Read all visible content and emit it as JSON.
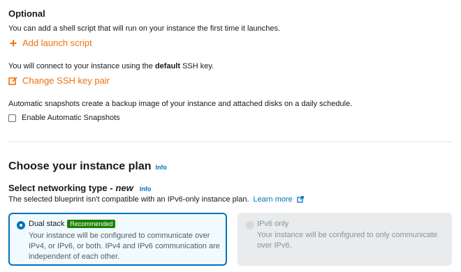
{
  "optional": {
    "title": "Optional",
    "launch_script_desc": "You can add a shell script that will run on your instance the first time it launches.",
    "add_launch_script": "Add launch script",
    "ssh_desc_before": "You will connect to your instance using the ",
    "ssh_desc_bold": "default",
    "ssh_desc_after": " SSH key.",
    "change_ssh": "Change SSH key pair",
    "snapshot_desc": "Automatic snapshots create a backup image of your instance and attached disks on a daily schedule.",
    "enable_snapshots": "Enable Automatic Snapshots"
  },
  "plan": {
    "title": "Choose your instance plan",
    "info": "Info"
  },
  "networking": {
    "title_prefix": "Select networking type - ",
    "title_new": "new",
    "info": "Info",
    "desc": "The selected blueprint isn't compatible with an IPv6-only instance plan.",
    "learn_more": "Learn more",
    "options": [
      {
        "label": "Dual stack",
        "badge": "Recommended",
        "desc_line1": "Your instance will be configured to communicate over",
        "desc_line2": "IPv4, or IPv6, or both. IPv4 and IPv6 communication are",
        "desc_line3": "independent of each other.",
        "selected": true
      },
      {
        "label": "IPv6 only",
        "desc_line1": "Your instance will be configured to only communicate",
        "desc_line2": "over IPv6.",
        "selected": false,
        "disabled": true
      }
    ]
  },
  "colors": {
    "accent": "#ec7211",
    "link": "#0073bb",
    "badge": "#1d8102"
  }
}
